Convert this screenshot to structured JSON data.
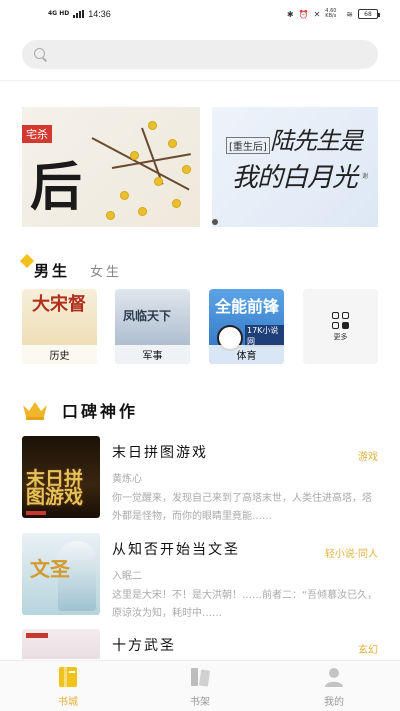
{
  "status_bar": {
    "network": "4G HD",
    "time": "14:36",
    "speed": "4.60 KB/s",
    "battery": "68"
  },
  "search": {
    "placeholder": ""
  },
  "banner": {
    "slide_1": {
      "tag": "宅杀",
      "title": "后"
    },
    "slide_2": {
      "tag": "[重生后]",
      "title_line_1": "陆先生是",
      "title_line_2": "我的白月光",
      "subtitle": "谢"
    }
  },
  "gender_tabs": {
    "male": "男生",
    "female": "女生",
    "active": "male"
  },
  "categories": [
    {
      "label": "历史",
      "cover_text": "大宋督",
      "icon": "history-cover"
    },
    {
      "label": "军事",
      "cover_text": "凤临天下",
      "icon": "military-cover"
    },
    {
      "label": "体育",
      "cover_text": "全能前锋",
      "cover_sub": "17K小说网",
      "icon": "sports-cover"
    },
    {
      "label": "更多",
      "icon": "more-grid-icon"
    }
  ],
  "section": {
    "title": "口碑神作",
    "icon": "crown-icon"
  },
  "books": [
    {
      "title": "末日拼图游戏",
      "tag": "游戏",
      "author": "黄炼心",
      "description": "你一觉醒来，发现自己来到了高塔末世，人类住进高塔，塔外都是怪物，而你的眼睛里竟能……",
      "cover_text": "末日拼图游戏"
    },
    {
      "title": "从知否开始当文圣",
      "tag": "轻小说·同人",
      "author": "入眠二",
      "description": "这里是大宋！不！是大洪朝！……前者二：“吾倾慕汝已久，原谅汝为知，耗时中……",
      "cover_text": "文圣"
    },
    {
      "title": "十方武圣",
      "tag": "玄幻",
      "author": "",
      "description": "",
      "cover_text": ""
    }
  ],
  "bottom_nav": [
    {
      "label": "书城",
      "icon": "bookstore-icon",
      "active": true
    },
    {
      "label": "书架",
      "icon": "bookshelf-icon",
      "active": false
    },
    {
      "label": "我的",
      "icon": "profile-icon",
      "active": false
    }
  ],
  "colors": {
    "accent": "#e2b13c",
    "tag": "#e2b13c",
    "tab_accent": "#f2c21c"
  }
}
